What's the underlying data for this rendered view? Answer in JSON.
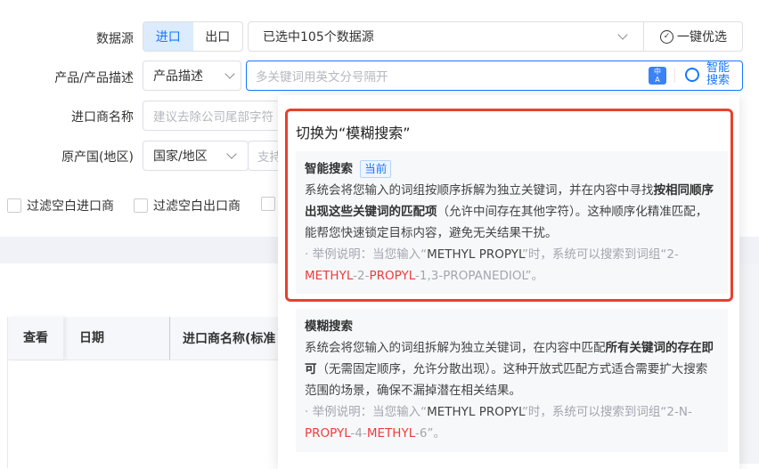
{
  "form": {
    "source_label": "数据源",
    "source_tabs": [
      "进口",
      "出口"
    ],
    "source_select": "已选中105个数据源",
    "one_click_label": "一键优选",
    "product_label": "产品/产品描述",
    "product_type": "产品描述",
    "product_placeholder": "多关键词用英文分号隔开",
    "smart_search_label": "智能搜索",
    "importer_label": "进口商名称",
    "importer_placeholder": "建议去除公司尾部字符",
    "origin_label": "原产国(地区)",
    "origin_type": "国家/地区",
    "origin_placeholder": "支持",
    "checkboxes": [
      "过滤空白进口商",
      "过滤空白出口商"
    ]
  },
  "table": {
    "headers": [
      "查看",
      "日期",
      "进口商名称(标准"
    ]
  },
  "popover": {
    "title": "切换为“模糊搜索”",
    "smart": {
      "title": "智能搜索",
      "badge": "当前",
      "desc_pre": "系统会将您输入的词组按顺序拆解为独立关键词，并在内容中寻找",
      "desc_bold": "按相同顺序出现这些关键词的匹配项",
      "desc_post": "（允许中间存在其他字符）。这种顺序化精准匹配，能帮您快速锁定目标内容，避免无关结果干扰。",
      "ex_pre": "· 举例说明：当您输入“",
      "ex_kw": "METHYL PROPYL",
      "ex_mid": "”时，系统可以搜索到词组“2-",
      "ex_r1": "METHYL",
      "ex_m2": "-2-",
      "ex_r2": "PROPYL",
      "ex_end": "-1,3-PROPANEDIOL”。"
    },
    "fuzzy": {
      "title": "模糊搜索",
      "desc_pre": "系统会将您输入的词组拆解为独立关键词，在内容中匹配",
      "desc_bold": "所有关键词的存在即可",
      "desc_post": "（无需固定顺序，允许分散出现）。这种开放式匹配方式适合需要扩大搜索范围的场景，确保不漏掉潜在相关结果。",
      "ex_pre": "· 举例说明：当您输入“",
      "ex_kw": "METHYL PROPYL",
      "ex_mid": "”时，系统可以搜索到词组“2-N-",
      "ex_r1": "PROPYL",
      "ex_m2": "-4-",
      "ex_r2": "METHYL",
      "ex_end": "-6”。"
    }
  },
  "colors": {
    "accent": "#1677ff",
    "highlight": "#e8412c",
    "keyword_red": "#f03c3c"
  }
}
